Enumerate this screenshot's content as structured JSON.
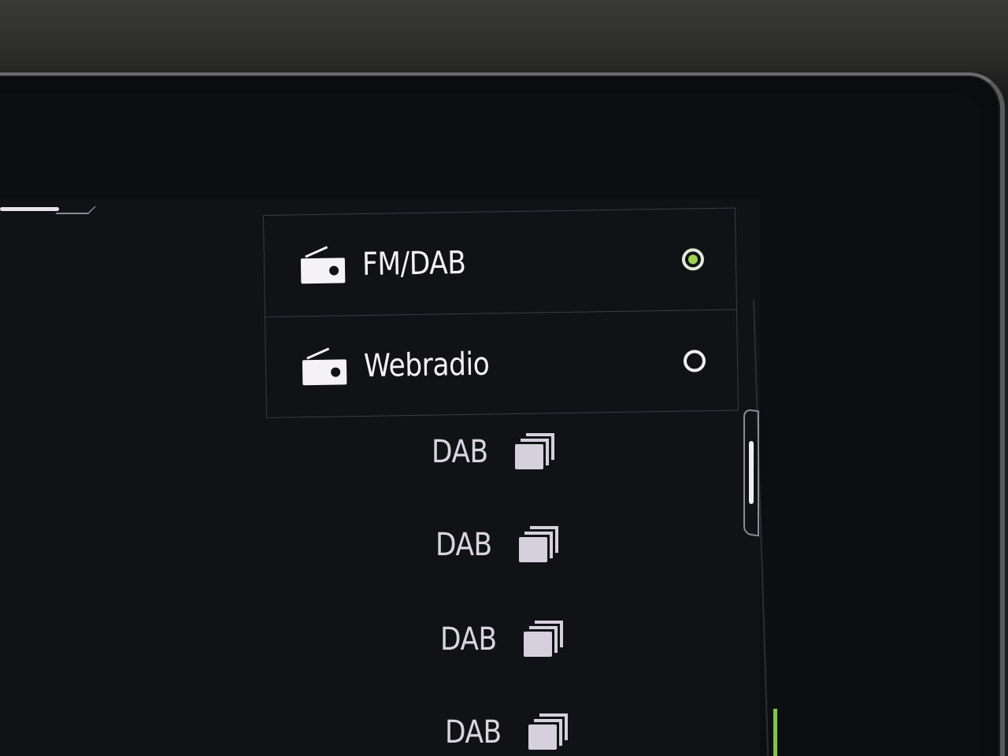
{
  "sources": [
    {
      "label": "FM/DAB",
      "icon": "radio-icon",
      "selected": true
    },
    {
      "label": "Webradio",
      "icon": "radio-icon",
      "selected": false
    }
  ],
  "stations": [
    {
      "label": "DAB",
      "icon": "stack-icon"
    },
    {
      "label": "DAB",
      "icon": "stack-icon"
    },
    {
      "label": "DAB",
      "icon": "stack-icon"
    },
    {
      "label": "DAB",
      "icon": "stack-icon"
    }
  ],
  "colors": {
    "selected_indicator": "#9ed34a",
    "text_primary": "#f4f2f6",
    "text_secondary": "#d9d4de",
    "accent_edge": "#7ec83a"
  }
}
